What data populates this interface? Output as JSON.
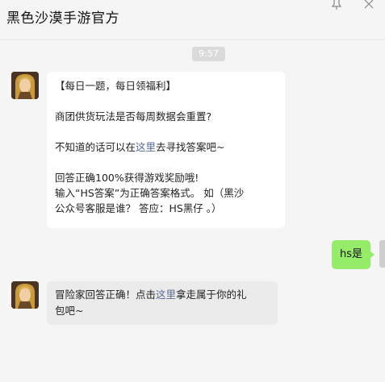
{
  "header": {
    "title": "黑色沙漠手游官方"
  },
  "chat": {
    "timestamp": "9:57",
    "msg1": {
      "line1": "【每日一题，每日领福利】",
      "line2": "商团供货玩法是否每周数据会重置?",
      "line3_pre": "不知道的话可以在",
      "line3_link": "这里",
      "line3_post": "去寻找答案吧~",
      "line4": "回答正确100%获得游戏奖励哦!",
      "line5": "输入“HS答案”为正确答案格式。 如（黑沙",
      "line6": "公众号客服是谁？ 答应：HS黑仔 。）"
    },
    "reply": {
      "text": "hs是"
    },
    "msg2": {
      "pre": "冒险家回答正确！点击",
      "link": "这里",
      "post": "拿走属于你的礼",
      "line2": "包吧~"
    }
  },
  "colors": {
    "background": "#f5f5f5",
    "outgoing_bubble": "#95ec69",
    "link": "#576b95"
  }
}
